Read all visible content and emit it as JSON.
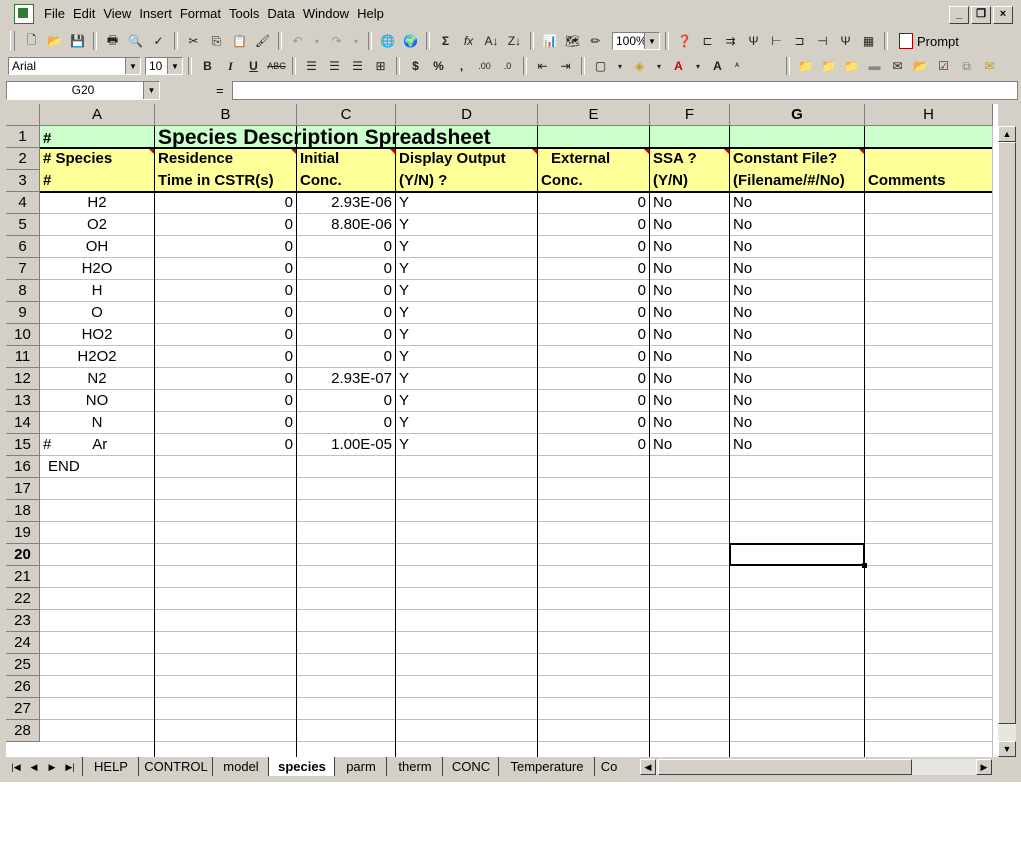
{
  "menu": [
    "File",
    "Edit",
    "View",
    "Insert",
    "Format",
    "Tools",
    "Data",
    "Window",
    "Help"
  ],
  "toolbar": {
    "zoom": "100%",
    "prompt_label": "Prompt",
    "font_name": "Arial",
    "font_size": "10"
  },
  "formula_bar": {
    "name_box": "G20",
    "equals": "=",
    "content": ""
  },
  "columns": [
    "A",
    "B",
    "C",
    "D",
    "E",
    "F",
    "G",
    "H"
  ],
  "selected_column": "G",
  "selected_row": "20",
  "rows": [
    "1",
    "2",
    "3",
    "4",
    "5",
    "6",
    "7",
    "8",
    "9",
    "10",
    "11",
    "12",
    "13",
    "14",
    "15",
    "16",
    "17",
    "18",
    "19",
    "20",
    "21",
    "22",
    "23",
    "24",
    "25",
    "26",
    "27",
    "28"
  ],
  "sheet": {
    "title_marker": "#",
    "title": "Species Description Spreadsheet",
    "headers": {
      "a2": "# Species",
      "a3": "#",
      "b2": "Residence",
      "b3": "Time in CSTR(s)",
      "c2": "Initial",
      "c3": "Conc.",
      "d2": "Display Output",
      "d3": "(Y/N) ?",
      "e2": "External",
      "e3": "Conc.",
      "f2": "SSA ?",
      "f3": "(Y/N)",
      "g2": "Constant File?",
      "g3": "(Filename/#/No)",
      "h3": "Comments"
    },
    "data": [
      {
        "species": "H2",
        "residence": "0",
        "initial": "2.93E-06",
        "display": "Y",
        "external": "0",
        "ssa": "No",
        "constant": "No"
      },
      {
        "species": "O2",
        "residence": "0",
        "initial": "8.80E-06",
        "display": "Y",
        "external": "0",
        "ssa": "No",
        "constant": "No"
      },
      {
        "species": "OH",
        "residence": "0",
        "initial": "0",
        "display": "Y",
        "external": "0",
        "ssa": "No",
        "constant": "No"
      },
      {
        "species": "H2O",
        "residence": "0",
        "initial": "0",
        "display": "Y",
        "external": "0",
        "ssa": "No",
        "constant": "No"
      },
      {
        "species": "H",
        "residence": "0",
        "initial": "0",
        "display": "Y",
        "external": "0",
        "ssa": "No",
        "constant": "No"
      },
      {
        "species": "O",
        "residence": "0",
        "initial": "0",
        "display": "Y",
        "external": "0",
        "ssa": "No",
        "constant": "No"
      },
      {
        "species": "HO2",
        "residence": "0",
        "initial": "0",
        "display": "Y",
        "external": "0",
        "ssa": "No",
        "constant": "No"
      },
      {
        "species": "H2O2",
        "residence": "0",
        "initial": "0",
        "display": "Y",
        "external": "0",
        "ssa": "No",
        "constant": "No"
      },
      {
        "species": "N2",
        "residence": "0",
        "initial": "2.93E-07",
        "display": "Y",
        "external": "0",
        "ssa": "No",
        "constant": "No"
      },
      {
        "species": "NO",
        "residence": "0",
        "initial": "0",
        "display": "Y",
        "external": "0",
        "ssa": "No",
        "constant": "No"
      },
      {
        "species": "N",
        "residence": "0",
        "initial": "0",
        "display": "Y",
        "external": "0",
        "ssa": "No",
        "constant": "No"
      },
      {
        "species": "#          Ar",
        "residence": "0",
        "initial": "1.00E-05",
        "display": "Y",
        "external": "0",
        "ssa": "No",
        "constant": "No"
      }
    ],
    "end_marker": "END"
  },
  "tabs": [
    "HELP",
    "CONTROL",
    "model",
    "species",
    "parm",
    "therm",
    "CONC",
    "Temperature",
    "Co"
  ],
  "active_tab": "species",
  "colors": {
    "title_fill": "#ccffcc",
    "header_fill": "#ffff99",
    "chrome": "#d4d0c8",
    "comment_marker": "#d00000"
  }
}
